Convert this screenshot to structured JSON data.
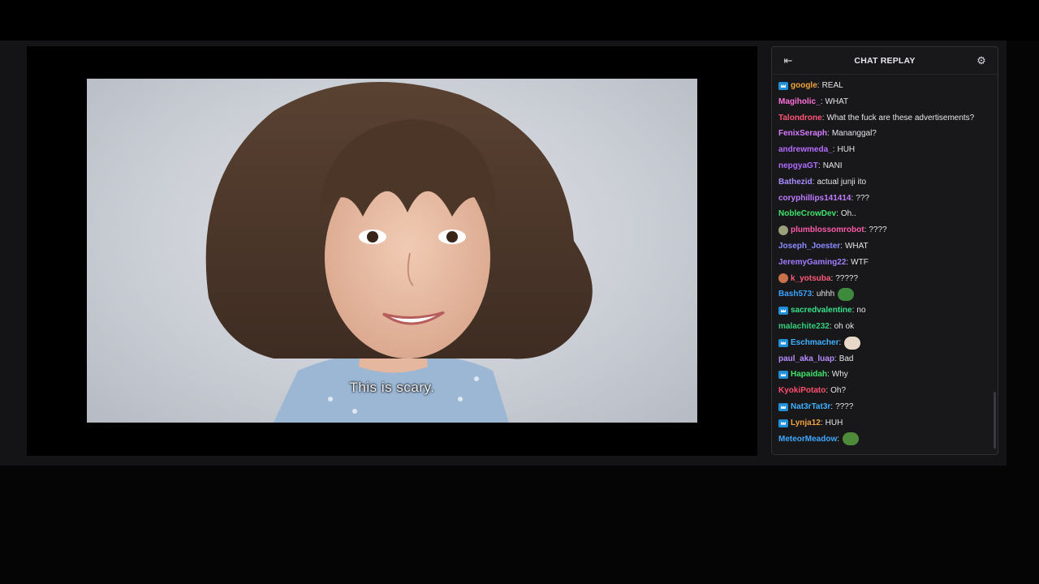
{
  "video": {
    "subtitle": "This is scary."
  },
  "chat": {
    "title": "CHAT REPLAY",
    "collapse_icon": "arrow-left-to-bar-icon",
    "settings_icon": "gear-icon",
    "messages": [
      {
        "user": "google",
        "text": "REAL",
        "color": "#f0a33d",
        "badge": true
      },
      {
        "user": "Magiholic_",
        "text": "WHAT",
        "color": "#ff6fd8"
      },
      {
        "user": "Talondrone",
        "text": "What the fuck are these advertisements?",
        "color": "#ff5577"
      },
      {
        "user": "FenixSeraph",
        "text": "Mananggal?",
        "color": "#d77bff"
      },
      {
        "user": "andrewmeda_",
        "text": "HUH",
        "color": "#b66cff"
      },
      {
        "user": "nepgyaGT",
        "text": "NANI",
        "color": "#b06cff"
      },
      {
        "user": "Bathezid",
        "text": "actual junji ito",
        "color": "#a88cff"
      },
      {
        "user": "coryphillips141414",
        "text": "???",
        "color": "#c07cff"
      },
      {
        "user": "NobleCrowDev",
        "text": "Oh..",
        "color": "#3fe36a"
      },
      {
        "user": "plumblossomrobot",
        "text": "????",
        "color": "#ff5aa8",
        "avatar": "#9aa07a"
      },
      {
        "user": "Joseph_Joester",
        "text": "WHAT",
        "color": "#8b8cff"
      },
      {
        "user": "JeremyGaming22",
        "text": "WTF",
        "color": "#a07cff"
      },
      {
        "user": "k_yotsuba",
        "text": "?????",
        "color": "#ff5a78",
        "avatar": "#c9714a"
      },
      {
        "user": "Bash573",
        "text": "uhhh",
        "color": "#3aa3ff",
        "emote": "#3d8a3d"
      },
      {
        "user": "sacredvalentine",
        "text": "no",
        "color": "#37e08a",
        "badge": true
      },
      {
        "user": "malachite232",
        "text": "oh ok",
        "color": "#34d07c"
      },
      {
        "user": "Eschmacher",
        "text": "",
        "color": "#3fb1ff",
        "badge": true,
        "emote": "#e8d8c8"
      },
      {
        "user": "paul_aka_luap",
        "text": "Bad",
        "color": "#b88cff"
      },
      {
        "user": "Hapaidah",
        "text": "Why",
        "color": "#3fe36a",
        "badge": true
      },
      {
        "user": "KyokiPotato",
        "text": "Oh?",
        "color": "#ff4f6e"
      },
      {
        "user": "Nat3rTat3r",
        "text": "????",
        "color": "#3fb1ff",
        "badge": true
      },
      {
        "user": "Lynja12",
        "text": "HUH",
        "color": "#f0a33d",
        "badge": true
      },
      {
        "user": "MeteorMeadow",
        "text": "",
        "color": "#3fa8ff",
        "emote": "#4f8a3a"
      }
    ]
  }
}
